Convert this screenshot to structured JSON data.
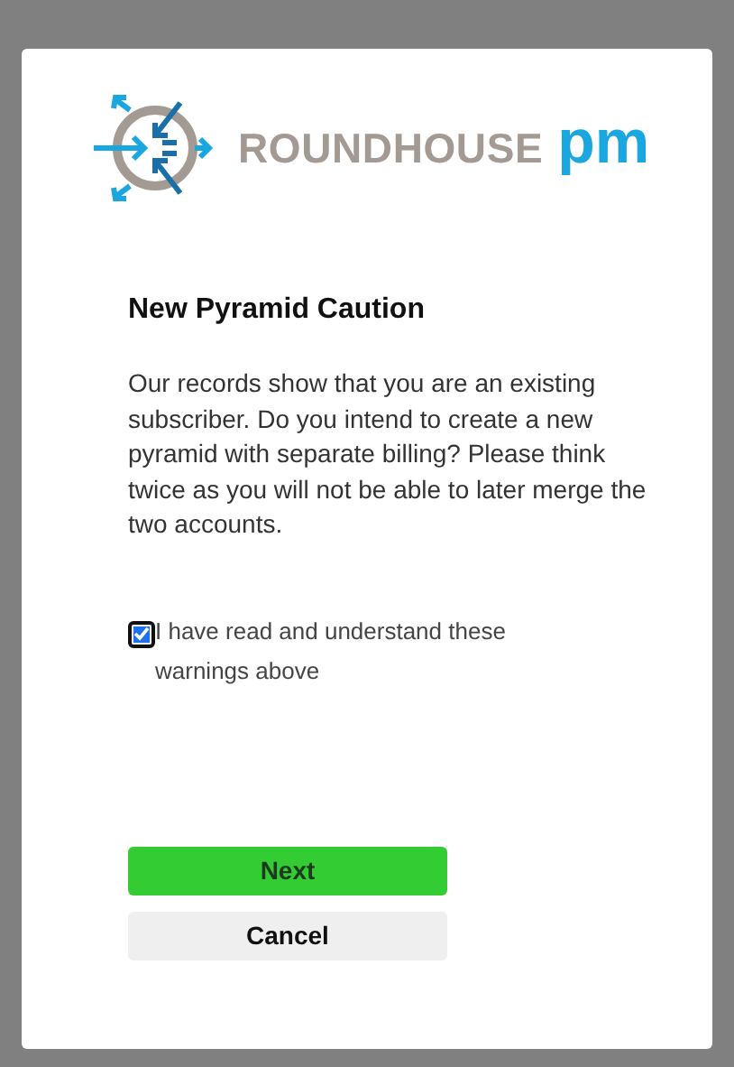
{
  "logo": {
    "word": "ROUNDHOUSE",
    "suffix": "pm"
  },
  "title": "New Pyramid Caution",
  "message": "Our records show that you are an existing subscriber. Do you intend to create a new pyramid with separate billing? Please think twice as you will not be able to later merge the two accounts.",
  "confirm": {
    "label": "I have read and understand these warnings above",
    "checked": true
  },
  "buttons": [
    {
      "label": "Next",
      "kind": "primary"
    },
    {
      "label": "Cancel",
      "kind": "secondary"
    }
  ]
}
